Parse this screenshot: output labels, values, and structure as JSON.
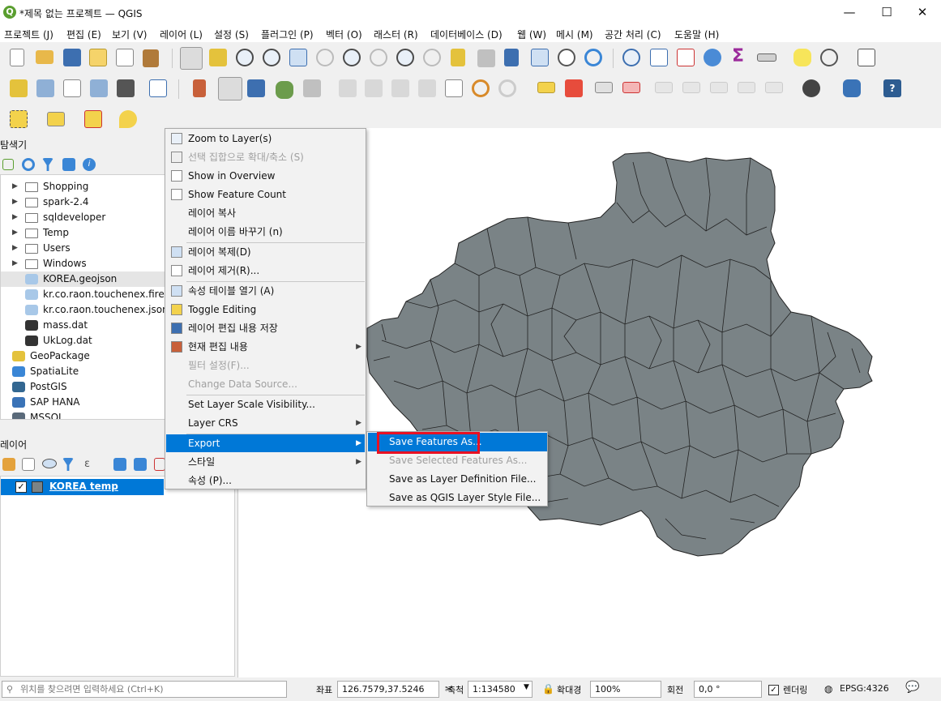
{
  "window": {
    "title": "*제목 없는 프로젝트 — QGIS",
    "app_icon": "Q",
    "minimize": "—",
    "maximize": "☐",
    "close": "✕"
  },
  "menubar": [
    "프로젝트 (J)",
    "편집 (E)",
    "보기 (V)",
    "레이어 (L)",
    "설정 (S)",
    "플러그인 (P)",
    "벡터 (O)",
    "래스터 (R)",
    "데이터베이스 (D)",
    "웹 (W)",
    "메시 (M)",
    "공간 처리 (C)",
    "도움말 (H)"
  ],
  "browser_panel": {
    "title": "탐색기",
    "items": [
      {
        "label": "Shopping",
        "icon": "folder-icon",
        "expandable": true,
        "indent": 1
      },
      {
        "label": "spark-2.4",
        "icon": "folder-icon",
        "expandable": true,
        "indent": 1
      },
      {
        "label": "sqldeveloper",
        "icon": "folder-icon",
        "expandable": true,
        "indent": 1
      },
      {
        "label": "Temp",
        "icon": "folder-icon",
        "expandable": true,
        "indent": 1
      },
      {
        "label": "Users",
        "icon": "folder-icon",
        "expandable": true,
        "indent": 1
      },
      {
        "label": "Windows",
        "icon": "folder-icon",
        "expandable": true,
        "indent": 1
      },
      {
        "label": "KOREA.geojson",
        "icon": "polygon-layer-icon",
        "expandable": false,
        "indent": 1
      },
      {
        "label": "kr.co.raon.touchenex.firefox",
        "icon": "polygon-layer-icon",
        "expandable": false,
        "indent": 1
      },
      {
        "label": "kr.co.raon.touchenex.json",
        "icon": "polygon-layer-icon",
        "expandable": false,
        "indent": 1
      },
      {
        "label": "mass.dat",
        "icon": "raster-layer-icon",
        "expandable": false,
        "indent": 1
      },
      {
        "label": "UkLog.dat",
        "icon": "raster-layer-icon",
        "expandable": false,
        "indent": 1
      },
      {
        "label": "GeoPackage",
        "icon": "geopackage-icon",
        "expandable": false,
        "indent": 0
      },
      {
        "label": "SpatiaLite",
        "icon": "spatialite-icon",
        "expandable": false,
        "indent": 0
      },
      {
        "label": "PostGIS",
        "icon": "postgis-icon",
        "expandable": false,
        "indent": 0
      },
      {
        "label": "SAP HANA",
        "icon": "saphana-icon",
        "expandable": false,
        "indent": 0
      },
      {
        "label": "MSSQL",
        "icon": "mssql-icon",
        "expandable": false,
        "indent": 0
      }
    ]
  },
  "layers_panel": {
    "title": "레이어",
    "layer": {
      "label": "KOREA temp",
      "checked": true
    }
  },
  "context_menu": {
    "items": [
      {
        "label": "Zoom to Layer(s)",
        "icon": "zoom-to-layer-icon",
        "disabled": false,
        "submenu": false
      },
      {
        "label": "선택 집합으로 확대/축소 (S)",
        "icon": "zoom-selection-icon",
        "disabled": true,
        "submenu": false
      },
      {
        "label": "Show in Overview",
        "icon": "overview-icon",
        "disabled": false,
        "submenu": false
      },
      {
        "label": "Show Feature Count",
        "icon": "checkbox-icon",
        "disabled": false,
        "submenu": false
      },
      {
        "label": "레이어 복사",
        "icon": "",
        "disabled": false,
        "submenu": false
      },
      {
        "label": "레이어 이름 바꾸기 (n)",
        "icon": "",
        "disabled": false,
        "submenu": false,
        "sep_after": true
      },
      {
        "label": "레이어 복제(D)",
        "icon": "duplicate-layer-icon",
        "disabled": false,
        "submenu": false
      },
      {
        "label": "레이어 제거(R)...",
        "icon": "remove-layer-icon",
        "disabled": false,
        "submenu": false,
        "sep_after": true
      },
      {
        "label": "속성 테이블 열기 (A)",
        "icon": "attribute-table-icon",
        "disabled": false,
        "submenu": false
      },
      {
        "label": "Toggle Editing",
        "icon": "pencil-icon",
        "disabled": false,
        "submenu": false
      },
      {
        "label": "레이어 편집 내용 저장",
        "icon": "save-edits-icon",
        "disabled": false,
        "submenu": false
      },
      {
        "label": "현재 편집 내용",
        "icon": "current-edits-icon",
        "disabled": false,
        "submenu": true
      },
      {
        "label": "필터 설정(F)...",
        "icon": "",
        "disabled": true,
        "submenu": false
      },
      {
        "label": "Change Data Source...",
        "icon": "",
        "disabled": true,
        "submenu": false,
        "sep_after": true
      },
      {
        "label": "Set Layer Scale Visibility...",
        "icon": "",
        "disabled": false,
        "submenu": false
      },
      {
        "label": "Layer CRS",
        "icon": "",
        "disabled": false,
        "submenu": true,
        "sep_after": true
      },
      {
        "label": "Export",
        "icon": "",
        "disabled": false,
        "submenu": true,
        "highlighted": true
      },
      {
        "label": "스타일",
        "icon": "",
        "disabled": false,
        "submenu": true
      },
      {
        "label": "속성 (P)...",
        "icon": "",
        "disabled": false,
        "submenu": false
      }
    ]
  },
  "export_submenu": {
    "items": [
      {
        "label": "Save Features As...",
        "disabled": false,
        "highlighted": true
      },
      {
        "label": "Save Selected Features As...",
        "disabled": true
      },
      {
        "label": "Save as Layer Definition File...",
        "disabled": false
      },
      {
        "label": "Save as QGIS Layer Style File...",
        "disabled": false
      }
    ]
  },
  "statusbar": {
    "locator_placeholder": "위치를 찾으려면 입력하세요 (Ctrl+K)",
    "coord_label": "좌표",
    "coord_value": "126.7579,37.5246",
    "scale_label": "축척",
    "scale_value": "1:134580",
    "magnifier_label": "확대경",
    "magnifier_value": "100%",
    "rotation_label": "회전",
    "rotation_value": "0,0 °",
    "render_label": "렌더링",
    "crs_label": "EPSG:4326"
  },
  "colors": {
    "accent": "#0078d7",
    "map_fill": "#7a8386",
    "highlight_box": "#e81123"
  }
}
